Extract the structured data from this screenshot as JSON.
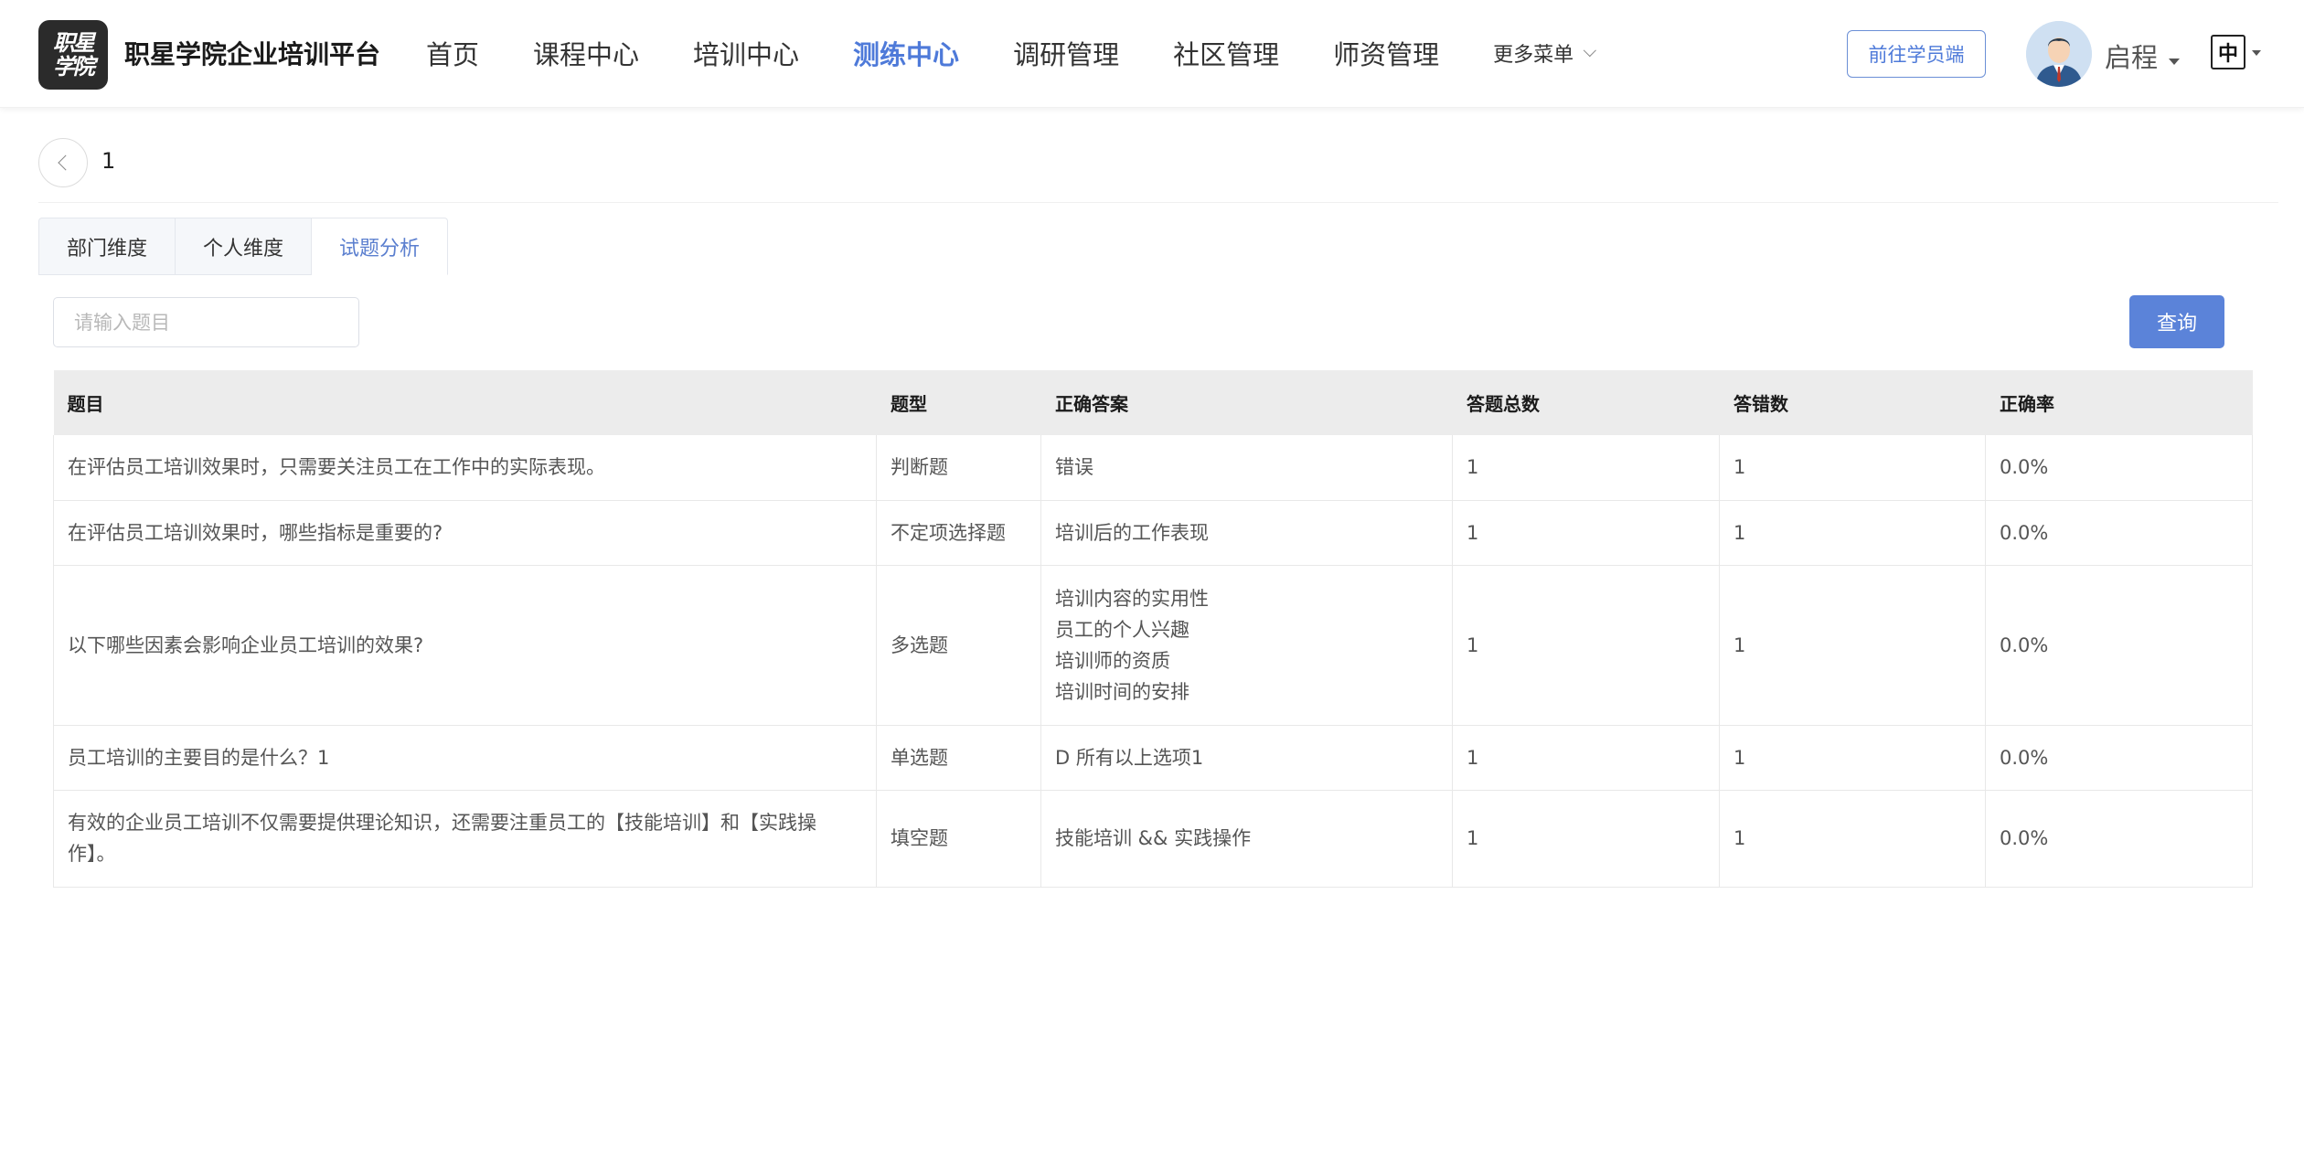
{
  "header": {
    "logo_line1": "职星",
    "logo_line2": "学院",
    "brand_title": "职星学院企业培训平台",
    "nav": [
      {
        "label": "首页",
        "active": false
      },
      {
        "label": "课程中心",
        "active": false
      },
      {
        "label": "培训中心",
        "active": false
      },
      {
        "label": "测练中心",
        "active": true
      },
      {
        "label": "调研管理",
        "active": false
      },
      {
        "label": "社区管理",
        "active": false
      },
      {
        "label": "师资管理",
        "active": false
      }
    ],
    "more_menu": "更多菜单",
    "student_button": "前往学员端",
    "user_name": "启程",
    "lang": "中"
  },
  "page": {
    "title": "1"
  },
  "tabs": [
    {
      "label": "部门维度",
      "active": false
    },
    {
      "label": "个人维度",
      "active": false
    },
    {
      "label": "试题分析",
      "active": true
    }
  ],
  "search": {
    "placeholder": "请输入题目",
    "value": "",
    "query_button": "查询"
  },
  "table": {
    "columns": [
      "题目",
      "题型",
      "正确答案",
      "答题总数",
      "答错数",
      "正确率"
    ],
    "rows": [
      {
        "question": "在评估员工培训效果时，只需要关注员工在工作中的实际表现。",
        "type": "判断题",
        "answer": [
          "错误"
        ],
        "total": "1",
        "wrong": "1",
        "rate": "0.0%"
      },
      {
        "question": "在评估员工培训效果时，哪些指标是重要的?",
        "type": "不定项选择题",
        "answer": [
          "培训后的工作表现"
        ],
        "total": "1",
        "wrong": "1",
        "rate": "0.0%"
      },
      {
        "question": "以下哪些因素会影响企业员工培训的效果?",
        "type": "多选题",
        "answer": [
          "培训内容的实用性",
          "员工的个人兴趣",
          "培训师的资质",
          "培训时间的安排"
        ],
        "total": "1",
        "wrong": "1",
        "rate": "0.0%"
      },
      {
        "question": "员工培训的主要目的是什么？1",
        "type": "单选题",
        "answer": [
          "D 所有以上选项1"
        ],
        "total": "1",
        "wrong": "1",
        "rate": "0.0%"
      },
      {
        "question": "有效的企业员工培训不仅需要提供理论知识，还需要注重员工的【技能培训】和【实践操作】。",
        "type": "填空题",
        "answer": [
          "技能培训 && 实践操作"
        ],
        "total": "1",
        "wrong": "1",
        "rate": "0.0%"
      }
    ]
  }
}
